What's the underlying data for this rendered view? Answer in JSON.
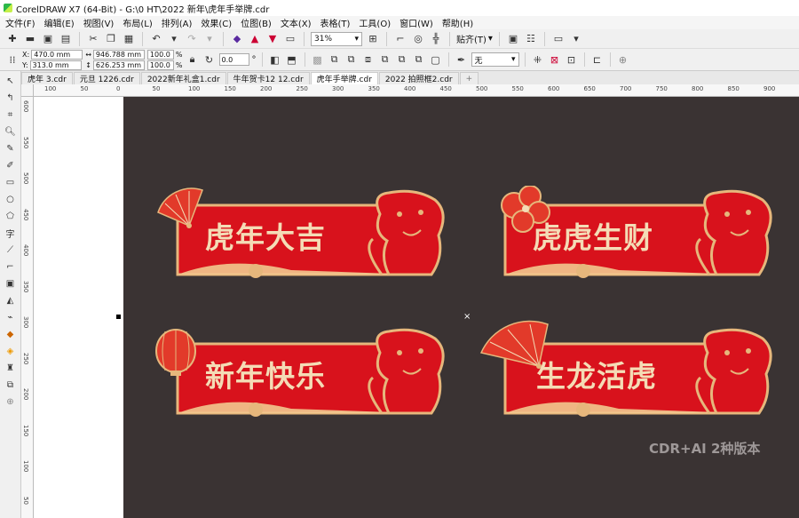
{
  "window": {
    "title": "CorelDRAW X7 (64-Bit) - G:\\0 HT\\2022 新年\\虎年手举牌.cdr"
  },
  "menu": [
    "文件(F)",
    "编辑(E)",
    "视图(V)",
    "布局(L)",
    "排列(A)",
    "效果(C)",
    "位图(B)",
    "文本(X)",
    "表格(T)",
    "工具(O)",
    "窗口(W)",
    "帮助(H)"
  ],
  "toolbar": {
    "zoom": "31%",
    "snap_label": "贴齐(T)"
  },
  "property_bar": {
    "x": "470.0 mm",
    "y": "313.0 mm",
    "width": "946.788 mm",
    "height": "626.253 mm",
    "scale_x": "100.0",
    "scale_y": "100.0",
    "percent": "%",
    "angle": "0.0",
    "degree": "°",
    "outline": "无"
  },
  "tabs": [
    "虎年 3.cdr",
    "元旦 1226.cdr",
    "2022新年礼盒1.cdr",
    "牛年贺卡12 12.cdr",
    "虎年手举牌.cdr",
    "2022 拍照框2.cdr"
  ],
  "active_tab": 4,
  "hruler_ticks": [
    "100",
    "50",
    "0",
    "50",
    "100",
    "150",
    "200",
    "250",
    "300",
    "350",
    "400",
    "450",
    "500",
    "550",
    "600",
    "650",
    "700",
    "750",
    "800",
    "850",
    "900"
  ],
  "vruler_ticks": [
    "600",
    "550",
    "500",
    "450",
    "400",
    "350",
    "300",
    "250",
    "200",
    "150",
    "100",
    "50"
  ],
  "banners": [
    {
      "text": "虎年大吉",
      "ornament": "fan"
    },
    {
      "text": "虎虎生财",
      "ornament": "flower"
    },
    {
      "text": "新年快乐",
      "ornament": "lantern"
    },
    {
      "text": "生龙活虎",
      "ornament": "fan"
    }
  ],
  "watermark": "CDR+AI 2种版本",
  "colors": {
    "banner_red": "#d8121c",
    "gold": "#e6b77c",
    "canvas_bg": "#3a3333"
  }
}
